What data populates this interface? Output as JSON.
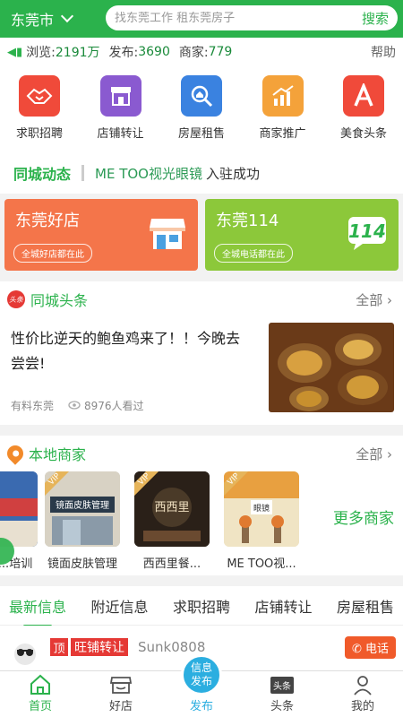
{
  "topbar": {
    "city": "东莞市",
    "search_placeholder": "找东莞工作 租东莞房子",
    "search_button": "搜索"
  },
  "stats": {
    "views_label": "浏览:",
    "views": "2191万",
    "posts_label": "发布:",
    "posts": "3690",
    "merchants_label": "商家:",
    "merchants": "779",
    "help": "帮助"
  },
  "categories": [
    {
      "label": "求职招聘",
      "icon": "handshake-icon",
      "color": "#f04a3a"
    },
    {
      "label": "店铺转让",
      "icon": "shop-icon",
      "color": "#8a5ad0"
    },
    {
      "label": "房屋租售",
      "icon": "house-search-icon",
      "color": "#3a82e0"
    },
    {
      "label": "商家推广",
      "icon": "growth-chart-icon",
      "color": "#f4a23a"
    },
    {
      "label": "美食头条",
      "icon": "food-a-icon",
      "color": "#f04a3a"
    }
  ],
  "news_ticker": {
    "tag": "同城动态",
    "highlight": "ME TOO视光眼镜",
    "text": "入驻成功"
  },
  "promo_cards": [
    {
      "title": "东莞好店",
      "pill": "全城好店都在此",
      "color": "#f4754a"
    },
    {
      "title": "东莞114",
      "pill": "全城电话都在此",
      "color": "#8cc83a",
      "badge": "114"
    }
  ],
  "headlines": {
    "badge": "头条",
    "title": "同城头条",
    "more": "全部 ›",
    "article": {
      "title": "性价比逆天的鲍鱼鸡来了！！今晚去尝尝!",
      "source": "有料东莞",
      "views": "8976人看过"
    }
  },
  "local_merchants": {
    "title": "本地商家",
    "more": "全部 ›",
    "more_link": "更多商家",
    "items": [
      {
        "name": "...培训",
        "vip": false
      },
      {
        "name": "镜面皮肤管理",
        "vip": true,
        "sign": "镜面皮肤管理"
      },
      {
        "name": "西西里餐...",
        "vip": true,
        "sign": "西西里"
      },
      {
        "name": "ME TOO视...",
        "vip": true,
        "sign": "眼镜"
      }
    ],
    "vip_text": "VIP"
  },
  "tabs": [
    "最新信息",
    "附近信息",
    "求职招聘",
    "店铺转让",
    "房屋租售"
  ],
  "listing": {
    "top_tag": "顶",
    "category": "旺铺转让",
    "user": "Sunk0808",
    "phone": "电话"
  },
  "bottom_nav": {
    "items": [
      {
        "label": "首页",
        "icon": "home-icon"
      },
      {
        "label": "好店",
        "icon": "store-icon"
      },
      {
        "label": "发布",
        "icon": "publish-icon"
      },
      {
        "label": "头条",
        "icon": "headline-icon"
      },
      {
        "label": "我的",
        "icon": "user-icon"
      }
    ],
    "publish_line1": "信息",
    "publish_line2": "发布",
    "headline_icon_text": "头条"
  }
}
